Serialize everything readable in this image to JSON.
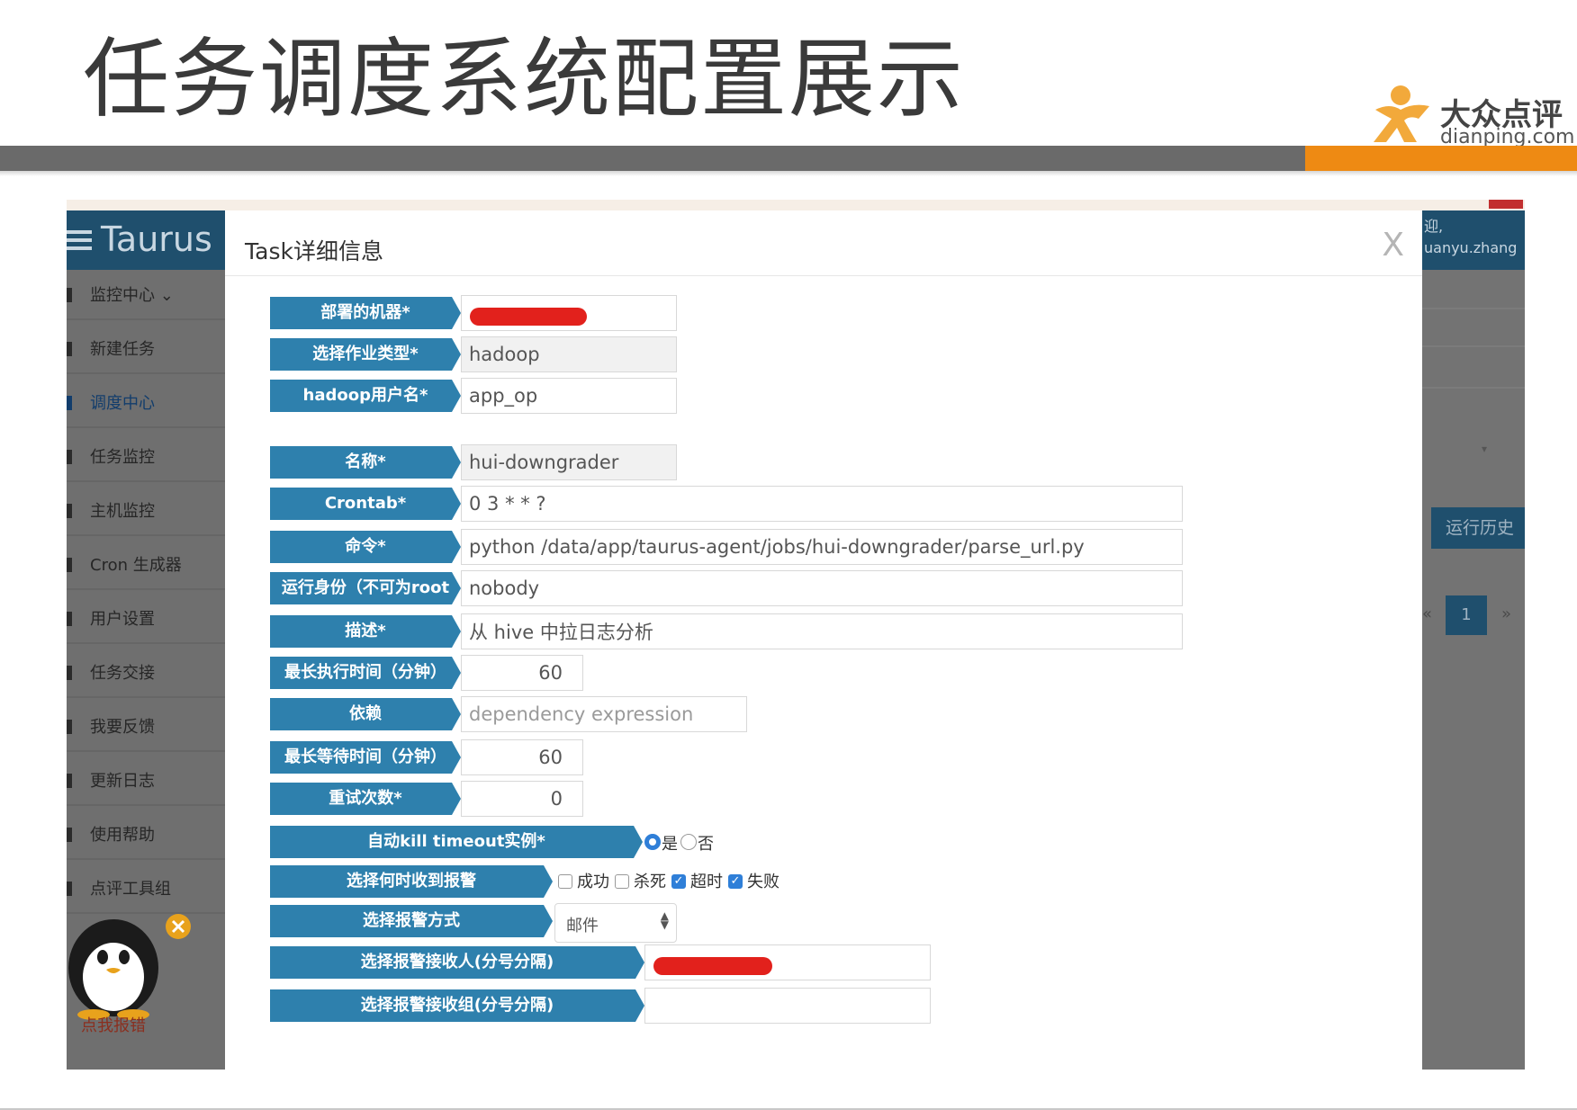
{
  "slide": {
    "title": "任务调度系统配置展示",
    "brand_cn": "大众点评",
    "brand_en": "dianping.com"
  },
  "colors": {
    "accent_orange": "#ee8a13",
    "label_blue": "#2e80ad",
    "nav_dark": "#1f4f6d"
  },
  "sidebar": {
    "logo": "Taurus",
    "items": [
      {
        "label": "监控中心 ⌄"
      },
      {
        "label": "新建任务"
      },
      {
        "label": "调度中心"
      },
      {
        "label": "任务监控"
      },
      {
        "label": "主机监控"
      },
      {
        "label": "Cron 生成器"
      },
      {
        "label": "用户设置"
      },
      {
        "label": "任务交接"
      },
      {
        "label": "我要反馈"
      },
      {
        "label": "更新日志"
      },
      {
        "label": "使用帮助"
      },
      {
        "label": "点评工具组"
      }
    ],
    "report_label": "点我报错"
  },
  "background_right": {
    "welcome": "迎,",
    "username": "uanyu.zhang",
    "history_button": "运行历史",
    "page_number": "1",
    "prev": "«",
    "next": "»"
  },
  "modal": {
    "title": "Task详细信息",
    "close": "X",
    "fields": {
      "machine": {
        "label": "部署的机器*",
        "value": ""
      },
      "job_type": {
        "label": "选择作业类型*",
        "value": "hadoop"
      },
      "hadoop_user": {
        "label": "hadoop用户名*",
        "value": "app_op"
      },
      "name": {
        "label": "名称*",
        "value": "hui-downgrader"
      },
      "crontab": {
        "label": "Crontab*",
        "value": "0 3 * * ?"
      },
      "command": {
        "label": "命令*",
        "value": "python /data/app/taurus-agent/jobs/hui-downgrader/parse_url.py"
      },
      "run_as": {
        "label": "运行身份（不可为root",
        "value": "nobody"
      },
      "description": {
        "label": "描述*",
        "value": "从 hive 中拉日志分析"
      },
      "max_exec_time": {
        "label": "最长执行时间（分钟）",
        "value": "60"
      },
      "dependency": {
        "label": "依赖",
        "placeholder": "dependency expression"
      },
      "max_wait_time": {
        "label": "最长等待时间（分钟）",
        "value": "60"
      },
      "retry_count": {
        "label": "重试次数*",
        "value": "0"
      },
      "auto_kill": {
        "label": "自动kill timeout实例*",
        "options": [
          "是",
          "否"
        ],
        "selected": "是"
      },
      "alert_when": {
        "label": "选择何时收到报警",
        "options": [
          {
            "label": "成功",
            "checked": false
          },
          {
            "label": "杀死",
            "checked": false
          },
          {
            "label": "超时",
            "checked": true
          },
          {
            "label": "失败",
            "checked": true
          }
        ]
      },
      "alert_method": {
        "label": "选择报警方式",
        "value": "邮件"
      },
      "alert_receivers": {
        "label": "选择报警接收人(分号分隔)",
        "value": ""
      },
      "alert_groups": {
        "label": "选择报警接收组(分号分隔)",
        "value": ""
      }
    }
  }
}
